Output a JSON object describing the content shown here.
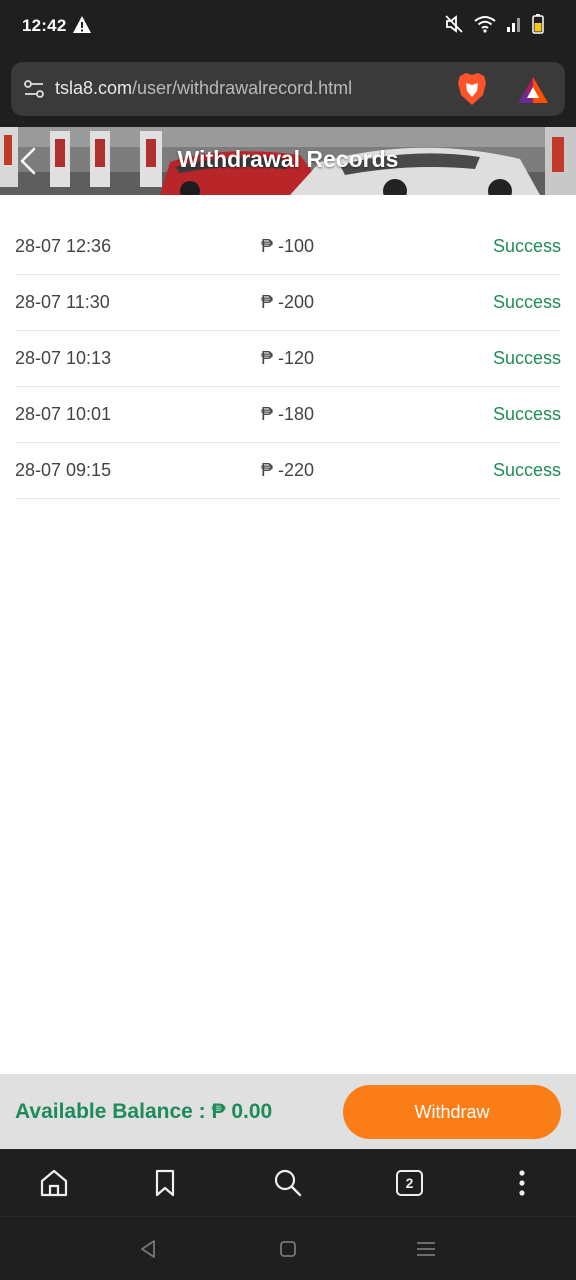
{
  "status_bar": {
    "time": "12:42"
  },
  "browser": {
    "url_domain": "tsla8.com",
    "url_path": "/user/withdrawalrecord.html",
    "tab_count": "2"
  },
  "header": {
    "title": "Withdrawal Records"
  },
  "records": [
    {
      "date": "28-07 12:36",
      "amount": "₱ -100",
      "status": "Success"
    },
    {
      "date": "28-07 11:30",
      "amount": "₱ -200",
      "status": "Success"
    },
    {
      "date": "28-07 10:13",
      "amount": "₱ -120",
      "status": "Success"
    },
    {
      "date": "28-07 10:01",
      "amount": "₱ -180",
      "status": "Success"
    },
    {
      "date": "28-07 09:15",
      "amount": "₱ -220",
      "status": "Success"
    }
  ],
  "footer": {
    "balance_label": "Available Balance : ₱ 0.00",
    "withdraw_label": "Withdraw"
  },
  "colors": {
    "accent_green": "#1e8c5a",
    "withdraw_orange": "#fb7d17"
  }
}
